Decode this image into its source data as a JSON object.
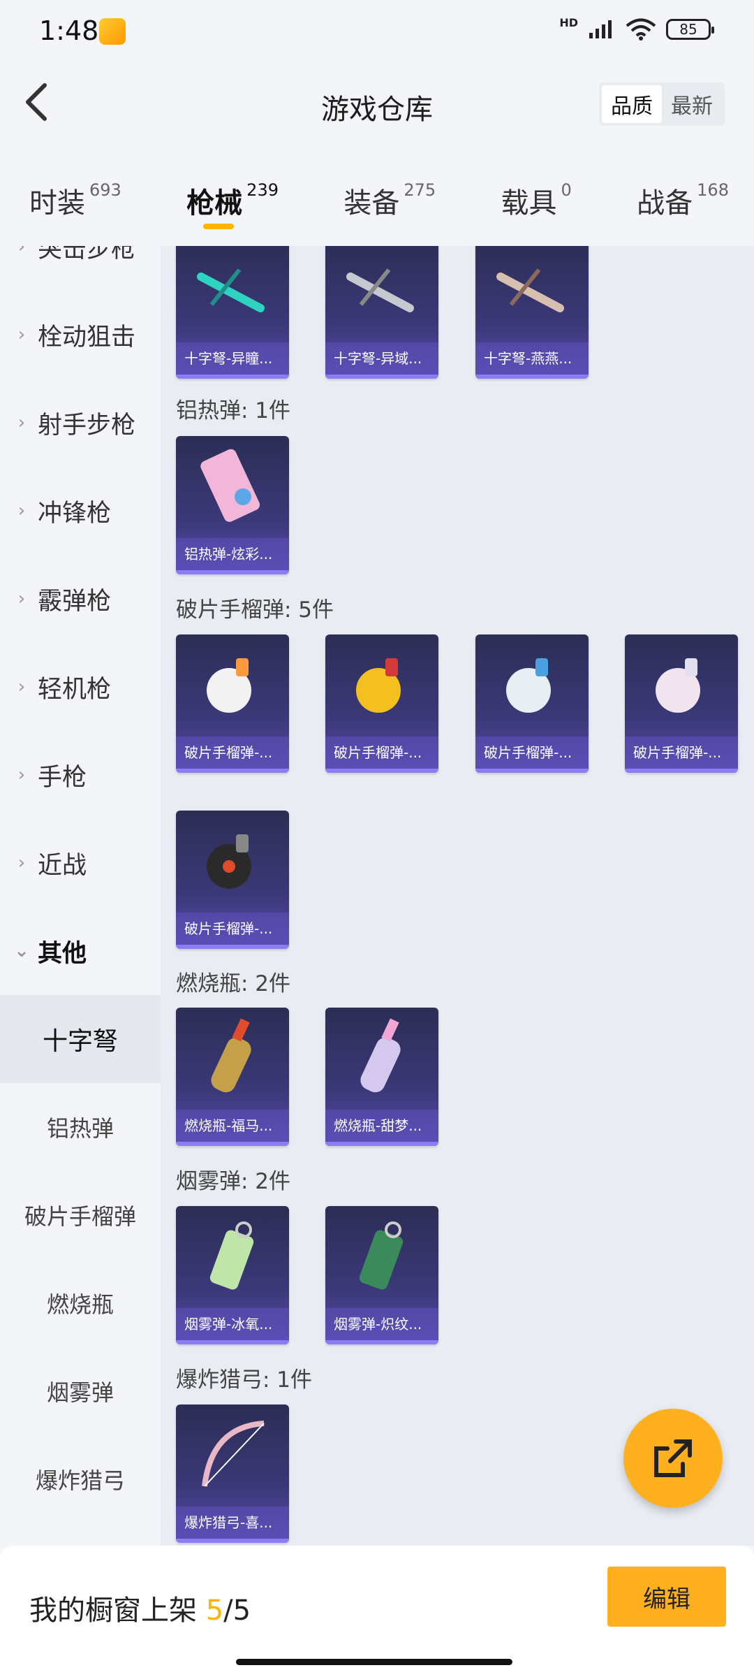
{
  "status": {
    "time": "1:48",
    "hd": "HD",
    "battery": "85"
  },
  "header": {
    "title": "游戏仓库",
    "sort": [
      "品质",
      "最新"
    ]
  },
  "tabs": [
    {
      "label": "时装",
      "count": "693"
    },
    {
      "label": "枪械",
      "count": "239"
    },
    {
      "label": "装备",
      "count": "275"
    },
    {
      "label": "载具",
      "count": "0"
    },
    {
      "label": "战备",
      "count": "168"
    }
  ],
  "sidebar": {
    "categories": [
      "突击步枪",
      "栓动狙击",
      "射手步枪",
      "冲锋枪",
      "霰弹枪",
      "轻机枪",
      "手枪",
      "近战",
      "其他"
    ],
    "sub": [
      "十字弩",
      "铝热弹",
      "破片手榴弹",
      "燃烧瓶",
      "烟雾弹",
      "爆炸猎弓"
    ]
  },
  "sections": [
    {
      "title": "",
      "items": [
        "十字弩-异瞳...",
        "十字弩-异域...",
        "十字弩-燕燕..."
      ]
    },
    {
      "title": "铝热弹: 1件",
      "items": [
        "铝热弹-炫彩..."
      ]
    },
    {
      "title": "破片手榴弹: 5件",
      "items": [
        "破片手榴弹-...",
        "破片手榴弹-...",
        "破片手榴弹-...",
        "破片手榴弹-...",
        "破片手榴弹-..."
      ]
    },
    {
      "title": "燃烧瓶: 2件",
      "items": [
        "燃烧瓶-福马...",
        "燃烧瓶-甜梦..."
      ]
    },
    {
      "title": "烟雾弹: 2件",
      "items": [
        "烟雾弹-冰氧...",
        "烟雾弹-炽纹..."
      ]
    },
    {
      "title": "爆炸猎弓: 1件",
      "items": [
        "爆炸猎弓-喜..."
      ]
    }
  ],
  "bottom": {
    "label": "我的橱窗上架",
    "shown": "5",
    "sep": "/",
    "total": "5",
    "edit": "编辑"
  }
}
